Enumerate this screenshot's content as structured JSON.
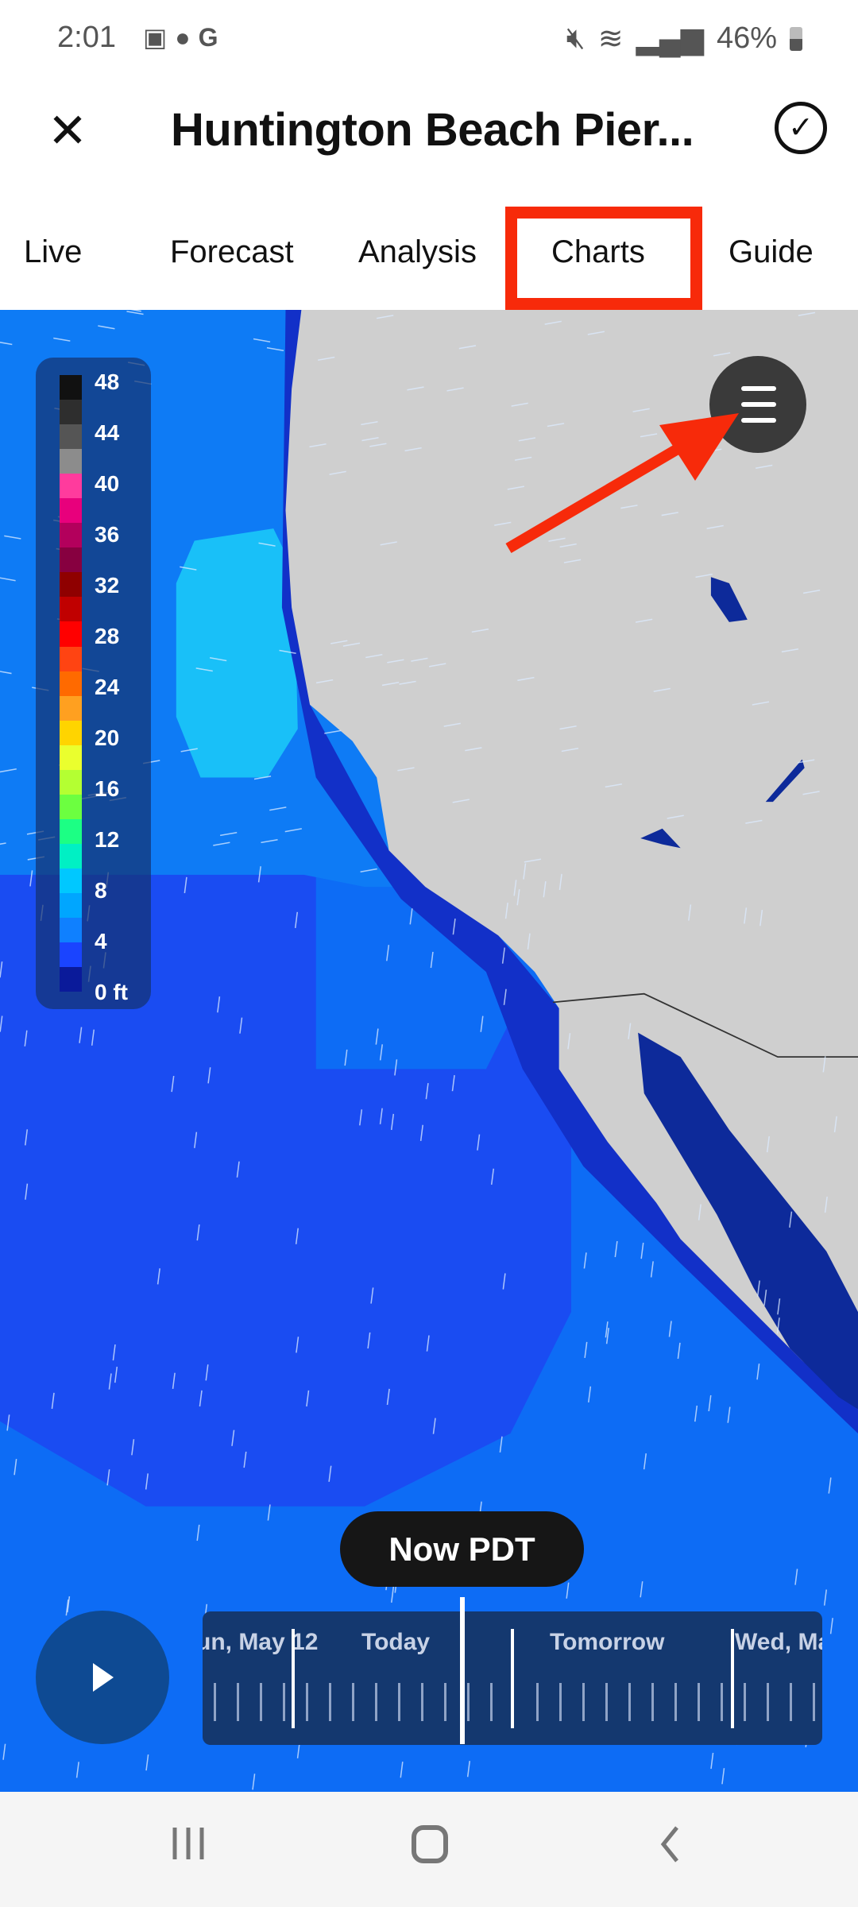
{
  "status_bar": {
    "time": "2:01",
    "battery": "46%",
    "icons": [
      "image-icon",
      "drop-icon",
      "google-icon",
      "mute-icon",
      "wifi-icon",
      "signal-icon",
      "battery-icon"
    ]
  },
  "header": {
    "title": "Huntington Beach Pier...",
    "close_icon": "close-icon",
    "confirm_icon": "check-circle-icon"
  },
  "tabs": [
    {
      "label": "Live"
    },
    {
      "label": "Forecast"
    },
    {
      "label": "Analysis"
    },
    {
      "label": "Charts",
      "selected": true,
      "highlighted": true
    },
    {
      "label": "Guide"
    }
  ],
  "legend": {
    "labels": [
      "48",
      "44",
      "40",
      "36",
      "32",
      "28",
      "24",
      "20",
      "16",
      "12",
      "8",
      "4",
      "0 ft"
    ],
    "colors": [
      "#111111",
      "#2e2e2e",
      "#555555",
      "#8c8c8c",
      "#ff3b9d",
      "#e8007c",
      "#b3005c",
      "#870040",
      "#8f0000",
      "#c00000",
      "#ff0000",
      "#ff4412",
      "#ff6a00",
      "#ffa020",
      "#ffd400",
      "#eaff2e",
      "#b4ff32",
      "#6cff40",
      "#1cff84",
      "#00f0c4",
      "#00c8ff",
      "#00a6ff",
      "#0f80ff",
      "#1a44ff",
      "#0a1a9a"
    ]
  },
  "map": {
    "menu_icon": "list-icon",
    "annotation": "red-arrow-pointing-to-menu",
    "ocean_color": "#0d6cf5",
    "land_color": "#cfcfcf"
  },
  "timeline": {
    "current": "Now PDT",
    "labels": [
      "un, May 12",
      "Today",
      "Tomorrow",
      "Wed, Ma"
    ],
    "play_icon": "play-icon"
  },
  "nav_bar": {
    "icons": [
      "recents-icon",
      "home-icon",
      "back-icon"
    ]
  }
}
